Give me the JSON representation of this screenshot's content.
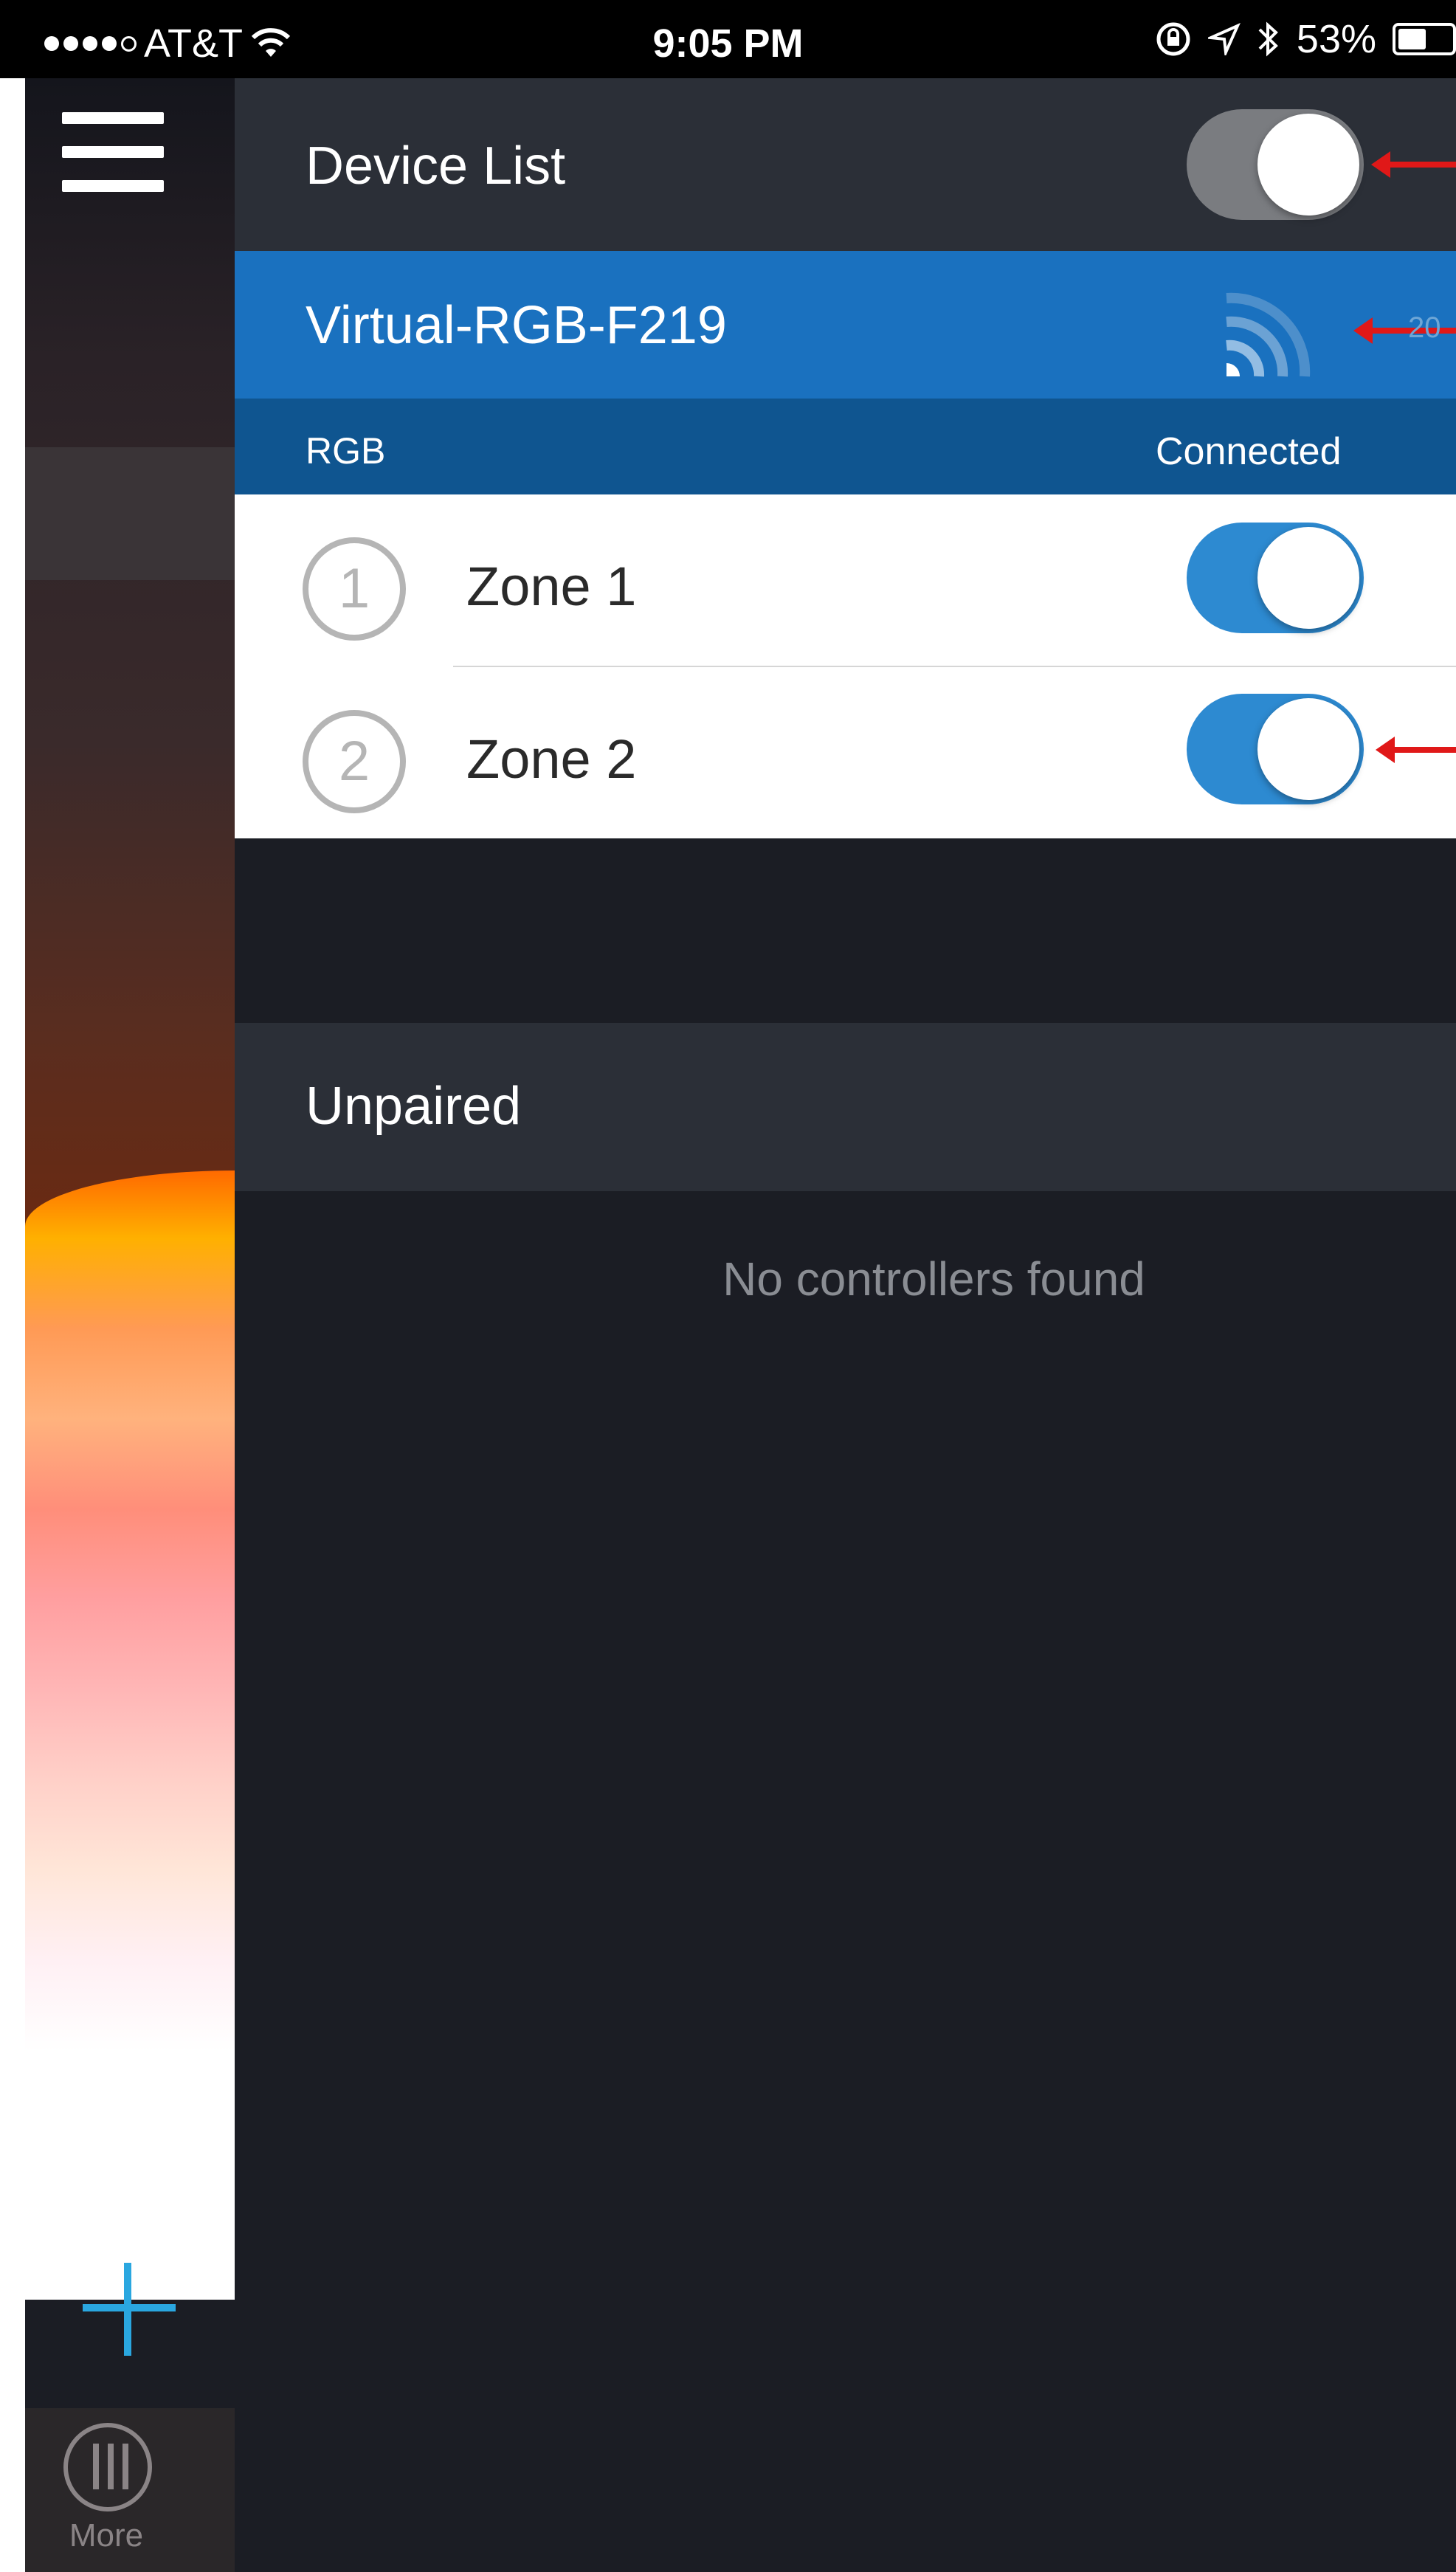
{
  "status_bar": {
    "carrier": "AT&T",
    "time": "9:05 PM",
    "battery": "53%",
    "battery_level": 0.53,
    "signal_bars": 4,
    "signal_total": 5
  },
  "side_rail": {
    "menu_icon": "hamburger-menu-icon",
    "add_icon": "plus-icon",
    "more_tab_label": "More",
    "more_icon": "mixer-sliders-icon",
    "accent_color": "#2aa7e0"
  },
  "device_list": {
    "title": "Device List",
    "master_toggle_on": true,
    "device": {
      "name": "Virtual-RGB-F219",
      "signal_icon": "wifi-signal-icon",
      "signal_value_partial": "20",
      "type": "RGB",
      "status": "Connected"
    },
    "zones": [
      {
        "number": "1",
        "label": "Zone 1",
        "enabled": true
      },
      {
        "number": "2",
        "label": "Zone 2",
        "enabled": true
      }
    ]
  },
  "unpaired": {
    "title": "Unpaired",
    "empty_message": "No controllers found"
  },
  "colors": {
    "device_row": "#1a71bf",
    "subheader": "#0f5590",
    "toggle_on": "#2d8ad1",
    "annotation_arrow": "#e01818"
  }
}
